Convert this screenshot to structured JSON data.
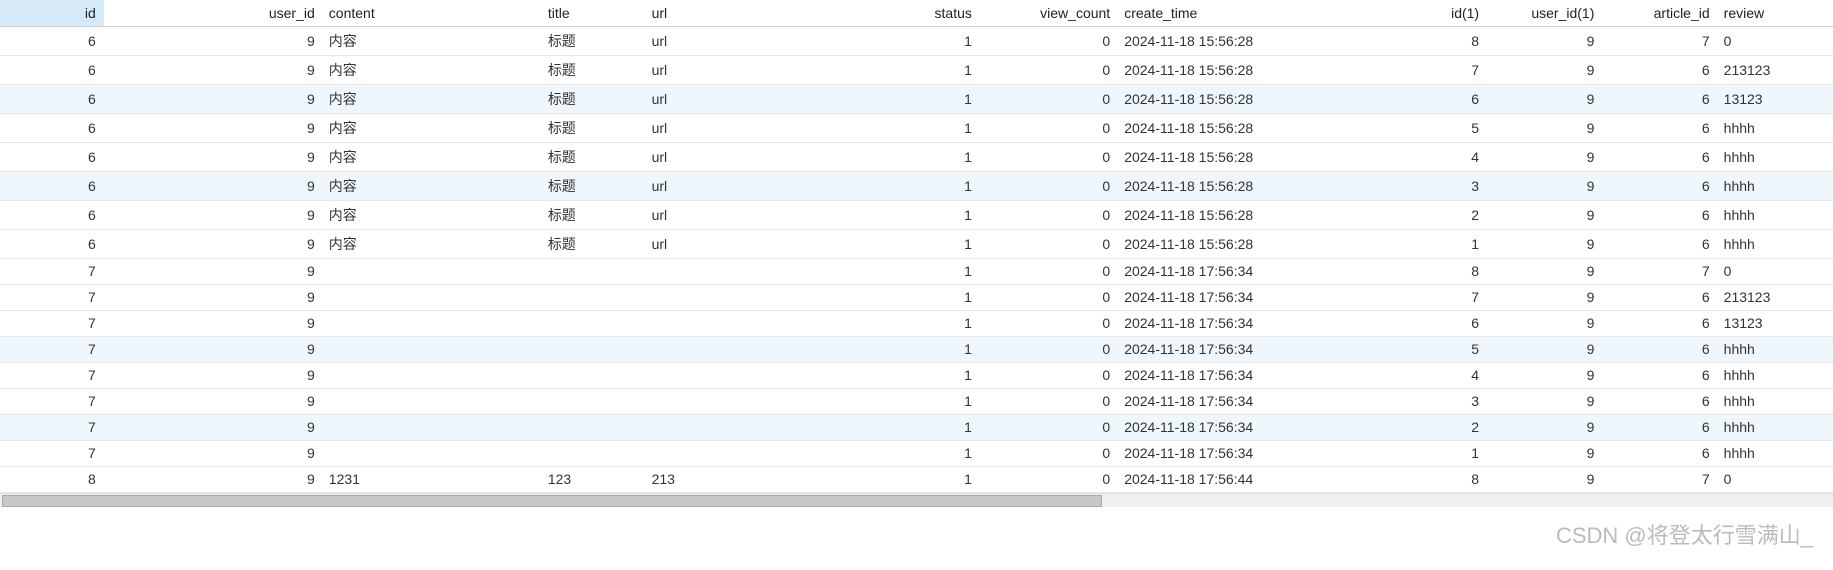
{
  "watermark": "CSDN @将登太行雪满山_",
  "columns": [
    {
      "key": "id",
      "label": "id",
      "cls": "num col-id",
      "selected": true
    },
    {
      "key": "user_id",
      "label": "user_id",
      "cls": "num col-user_id"
    },
    {
      "key": "content",
      "label": "content",
      "cls": "col-content"
    },
    {
      "key": "title",
      "label": "title",
      "cls": "col-title"
    },
    {
      "key": "url",
      "label": "url",
      "cls": "col-url"
    },
    {
      "key": "status",
      "label": "status",
      "cls": "num col-status"
    },
    {
      "key": "view_count",
      "label": "view_count",
      "cls": "num col-view_count"
    },
    {
      "key": "create_time",
      "label": "create_time",
      "cls": "col-create_time"
    },
    {
      "key": "id1",
      "label": "id(1)",
      "cls": "num col-id1"
    },
    {
      "key": "user_id1",
      "label": "user_id(1)",
      "cls": "num col-user_id1"
    },
    {
      "key": "article_id",
      "label": "article_id",
      "cls": "num col-article_id"
    },
    {
      "key": "review",
      "label": "review",
      "cls": "col-review"
    }
  ],
  "rows": [
    {
      "id": "6",
      "user_id": "9",
      "content": "内容",
      "title": "标题",
      "url": "url",
      "status": "1",
      "view_count": "0",
      "create_time": "2024-11-18 15:56:28",
      "id1": "8",
      "user_id1": "9",
      "article_id": "7",
      "review": "0"
    },
    {
      "id": "6",
      "user_id": "9",
      "content": "内容",
      "title": "标题",
      "url": "url",
      "status": "1",
      "view_count": "0",
      "create_time": "2024-11-18 15:56:28",
      "id1": "7",
      "user_id1": "9",
      "article_id": "6",
      "review": "213123"
    },
    {
      "id": "6",
      "user_id": "9",
      "content": "内容",
      "title": "标题",
      "url": "url",
      "status": "1",
      "view_count": "0",
      "create_time": "2024-11-18 15:56:28",
      "id1": "6",
      "user_id1": "9",
      "article_id": "6",
      "review": "13123"
    },
    {
      "id": "6",
      "user_id": "9",
      "content": "内容",
      "title": "标题",
      "url": "url",
      "status": "1",
      "view_count": "0",
      "create_time": "2024-11-18 15:56:28",
      "id1": "5",
      "user_id1": "9",
      "article_id": "6",
      "review": "hhhh"
    },
    {
      "id": "6",
      "user_id": "9",
      "content": "内容",
      "title": "标题",
      "url": "url",
      "status": "1",
      "view_count": "0",
      "create_time": "2024-11-18 15:56:28",
      "id1": "4",
      "user_id1": "9",
      "article_id": "6",
      "review": "hhhh"
    },
    {
      "id": "6",
      "user_id": "9",
      "content": "内容",
      "title": "标题",
      "url": "url",
      "status": "1",
      "view_count": "0",
      "create_time": "2024-11-18 15:56:28",
      "id1": "3",
      "user_id1": "9",
      "article_id": "6",
      "review": "hhhh"
    },
    {
      "id": "6",
      "user_id": "9",
      "content": "内容",
      "title": "标题",
      "url": "url",
      "status": "1",
      "view_count": "0",
      "create_time": "2024-11-18 15:56:28",
      "id1": "2",
      "user_id1": "9",
      "article_id": "6",
      "review": "hhhh"
    },
    {
      "id": "6",
      "user_id": "9",
      "content": "内容",
      "title": "标题",
      "url": "url",
      "status": "1",
      "view_count": "0",
      "create_time": "2024-11-18 15:56:28",
      "id1": "1",
      "user_id1": "9",
      "article_id": "6",
      "review": "hhhh"
    },
    {
      "id": "7",
      "user_id": "9",
      "content": "",
      "title": "",
      "url": "",
      "status": "1",
      "view_count": "0",
      "create_time": "2024-11-18 17:56:34",
      "id1": "8",
      "user_id1": "9",
      "article_id": "7",
      "review": "0"
    },
    {
      "id": "7",
      "user_id": "9",
      "content": "",
      "title": "",
      "url": "",
      "status": "1",
      "view_count": "0",
      "create_time": "2024-11-18 17:56:34",
      "id1": "7",
      "user_id1": "9",
      "article_id": "6",
      "review": "213123"
    },
    {
      "id": "7",
      "user_id": "9",
      "content": "",
      "title": "",
      "url": "",
      "status": "1",
      "view_count": "0",
      "create_time": "2024-11-18 17:56:34",
      "id1": "6",
      "user_id1": "9",
      "article_id": "6",
      "review": "13123"
    },
    {
      "id": "7",
      "user_id": "9",
      "content": "",
      "title": "",
      "url": "",
      "status": "1",
      "view_count": "0",
      "create_time": "2024-11-18 17:56:34",
      "id1": "5",
      "user_id1": "9",
      "article_id": "6",
      "review": "hhhh"
    },
    {
      "id": "7",
      "user_id": "9",
      "content": "",
      "title": "",
      "url": "",
      "status": "1",
      "view_count": "0",
      "create_time": "2024-11-18 17:56:34",
      "id1": "4",
      "user_id1": "9",
      "article_id": "6",
      "review": "hhhh"
    },
    {
      "id": "7",
      "user_id": "9",
      "content": "",
      "title": "",
      "url": "",
      "status": "1",
      "view_count": "0",
      "create_time": "2024-11-18 17:56:34",
      "id1": "3",
      "user_id1": "9",
      "article_id": "6",
      "review": "hhhh"
    },
    {
      "id": "7",
      "user_id": "9",
      "content": "",
      "title": "",
      "url": "",
      "status": "1",
      "view_count": "0",
      "create_time": "2024-11-18 17:56:34",
      "id1": "2",
      "user_id1": "9",
      "article_id": "6",
      "review": "hhhh"
    },
    {
      "id": "7",
      "user_id": "9",
      "content": "",
      "title": "",
      "url": "",
      "status": "1",
      "view_count": "0",
      "create_time": "2024-11-18 17:56:34",
      "id1": "1",
      "user_id1": "9",
      "article_id": "6",
      "review": "hhhh"
    },
    {
      "id": "8",
      "user_id": "9",
      "content": "1231",
      "title": "123",
      "url": "213",
      "status": "1",
      "view_count": "0",
      "create_time": "2024-11-18 17:56:44",
      "id1": "8",
      "user_id1": "9",
      "article_id": "7",
      "review": "0"
    }
  ]
}
